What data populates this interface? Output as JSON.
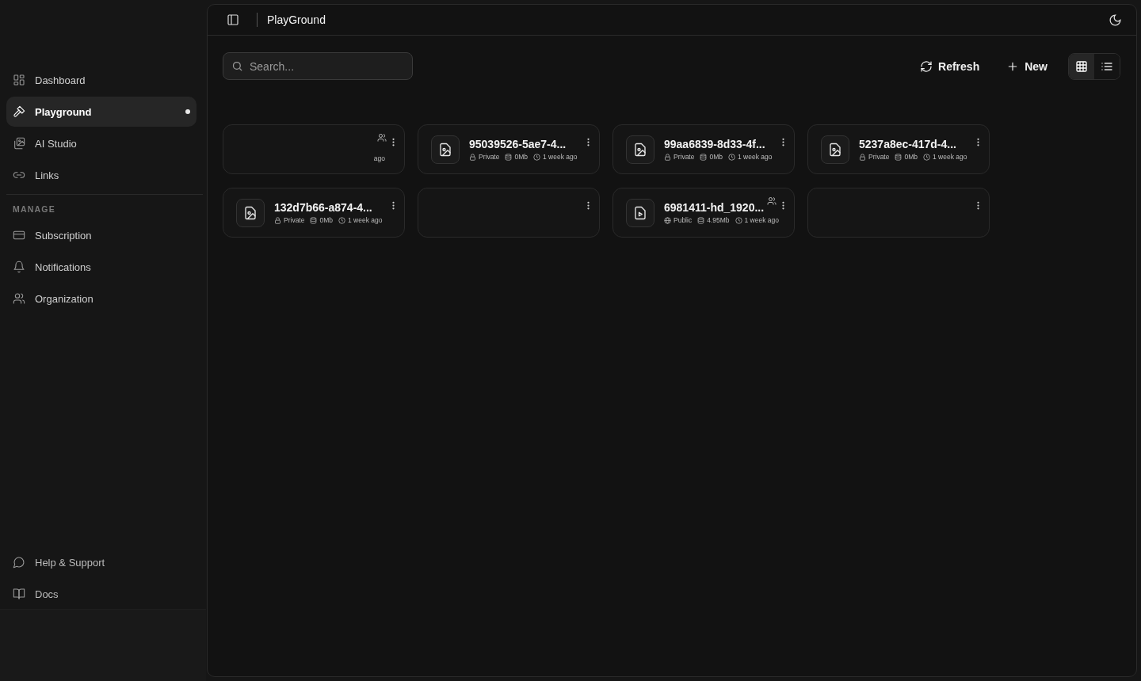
{
  "sidebar": {
    "items": [
      {
        "label": "Dashboard",
        "selected": false
      },
      {
        "label": "Playground",
        "selected": true
      },
      {
        "label": "AI Studio",
        "selected": false
      },
      {
        "label": "Links",
        "selected": false
      }
    ],
    "section_label": "MANAGE",
    "manage_items": [
      {
        "label": "Subscription",
        "selected": false
      },
      {
        "label": "Notifications",
        "selected": false
      },
      {
        "label": "Organization",
        "selected": false
      }
    ],
    "footer_items": [
      {
        "label": "Help & Support"
      },
      {
        "label": "Docs"
      }
    ]
  },
  "header": {
    "title": "PlayGround"
  },
  "toolbar": {
    "search": {
      "placeholder": "Search..."
    },
    "refresh": "Refresh",
    "new": "New",
    "views": [
      {
        "kind": "grid",
        "selected": true
      },
      {
        "kind": "list",
        "selected": false
      }
    ]
  },
  "files": [
    {
      "kind": "hidden",
      "shared": true,
      "fragment": "ago"
    },
    {
      "kind": "image",
      "title": "95039526-5ae7-4...",
      "visibility": {
        "kind": "private",
        "label": "Private"
      },
      "size": "0Mb",
      "time": "1 week ago",
      "shared": false
    },
    {
      "kind": "image",
      "title": "99aa6839-8d33-4f...",
      "visibility": {
        "kind": "private",
        "label": "Private"
      },
      "size": "0Mb",
      "time": "1 week ago",
      "shared": false
    },
    {
      "kind": "image",
      "title": "5237a8ec-417d-4...",
      "visibility": {
        "kind": "private",
        "label": "Private"
      },
      "size": "0Mb",
      "time": "1 week ago",
      "shared": false
    },
    {
      "kind": "image",
      "title": "132d7b66-a874-4...",
      "visibility": {
        "kind": "private",
        "label": "Private"
      },
      "size": "0Mb",
      "time": "1 week ago",
      "shared": false
    },
    {
      "kind": "hidden",
      "shared": false
    },
    {
      "kind": "video",
      "title": "6981411-hd_1920...",
      "visibility": {
        "kind": "public",
        "label": "Public"
      },
      "size": "4.95Mb",
      "time": "1 week ago",
      "shared": true
    },
    {
      "kind": "hidden",
      "shared": false
    }
  ]
}
